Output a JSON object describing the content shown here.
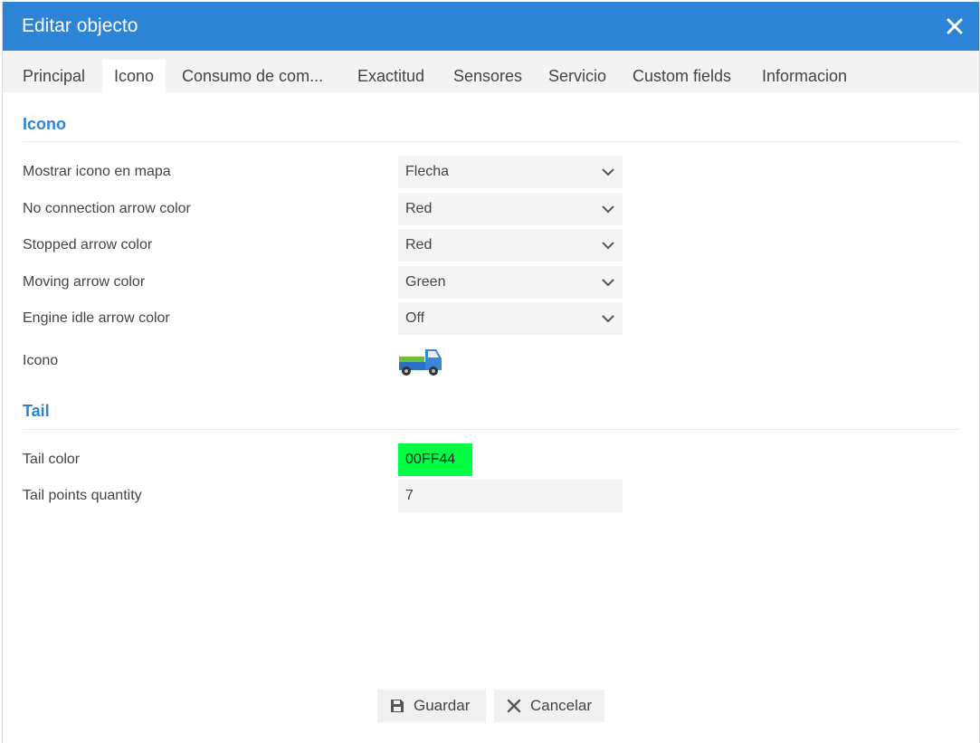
{
  "dialog": {
    "title": "Editar objecto",
    "close_icon": "close-icon"
  },
  "tabs": [
    {
      "label": "Principal"
    },
    {
      "label": "Icono",
      "active": true
    },
    {
      "label": "Consumo de com..."
    },
    {
      "label": "Exactitud"
    },
    {
      "label": "Sensores"
    },
    {
      "label": "Servicio"
    },
    {
      "label": "Custom fields"
    },
    {
      "label": "Informacion"
    }
  ],
  "icon_section": {
    "title": "Icono",
    "fields": [
      {
        "label": "Mostrar icono en mapa",
        "value": "Flecha"
      },
      {
        "label": "No connection arrow color",
        "value": "Red"
      },
      {
        "label": "Stopped arrow color",
        "value": "Red"
      },
      {
        "label": "Moving arrow color",
        "value": "Green"
      },
      {
        "label": "Engine idle arrow color",
        "value": "Off"
      }
    ],
    "icon_label": "Icono",
    "icon_image": "truck-icon"
  },
  "tail_section": {
    "title": "Tail",
    "color_label": "Tail color",
    "color_value": "00FF44",
    "color_swatch": "#00FF44",
    "points_label": "Tail points quantity",
    "points_value": "7"
  },
  "footer": {
    "save_label": "Guardar",
    "cancel_label": "Cancelar"
  },
  "colors": {
    "header": "#2B84D6",
    "section_title": "#2B84D6"
  }
}
